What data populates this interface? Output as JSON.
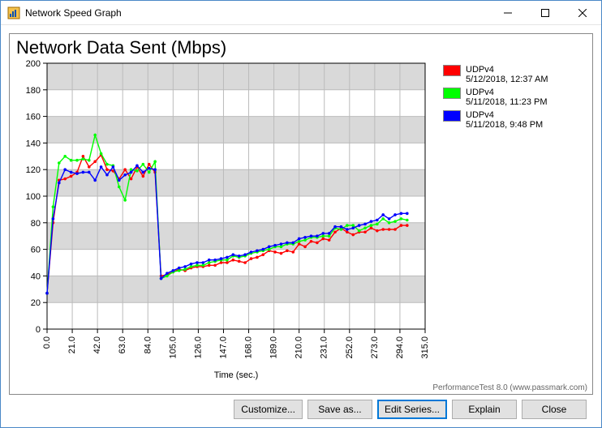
{
  "window": {
    "title": "Network Speed Graph"
  },
  "chart": {
    "title": "Network Data Sent (Mbps)"
  },
  "chart_data": {
    "type": "line",
    "title": "Network Data Sent (Mbps)",
    "xlabel": "Time (sec.)",
    "ylabel": "",
    "ylim": [
      0,
      200
    ],
    "xlim": [
      0,
      315
    ],
    "xticks": [
      0.0,
      21.0,
      42.0,
      63.0,
      84.0,
      105.0,
      126.0,
      147.0,
      168.0,
      189.0,
      210.0,
      231.0,
      252.0,
      273.0,
      294.0,
      315.0
    ],
    "yticks": [
      0,
      20,
      40,
      60,
      80,
      100,
      120,
      140,
      160,
      180,
      200
    ],
    "x": [
      0,
      5,
      10,
      15,
      20,
      25,
      30,
      35,
      40,
      45,
      50,
      55,
      60,
      65,
      70,
      75,
      80,
      85,
      90,
      95,
      100,
      105,
      110,
      115,
      120,
      125,
      130,
      135,
      140,
      145,
      150,
      155,
      160,
      165,
      170,
      175,
      180,
      185,
      190,
      195,
      200,
      205,
      210,
      215,
      220,
      225,
      230,
      235,
      240,
      245,
      250,
      255,
      260,
      265,
      270,
      275,
      280,
      285,
      290,
      295,
      300
    ],
    "series": [
      {
        "name": "UDPv4",
        "subtitle": "5/12/2018, 12:37 AM",
        "color": "#ff0000",
        "values": [
          27,
          80,
          112,
          113,
          115,
          118,
          130,
          122,
          126,
          131,
          120,
          119,
          113,
          120,
          113,
          122,
          115,
          124,
          118,
          40,
          41,
          43,
          45,
          44,
          46,
          47,
          47,
          48,
          48,
          50,
          50,
          52,
          51,
          50,
          53,
          54,
          56,
          59,
          58,
          57,
          59,
          58,
          64,
          62,
          66,
          65,
          68,
          67,
          73,
          76,
          73,
          71,
          73,
          73,
          76,
          74,
          75,
          75,
          75,
          78,
          78
        ]
      },
      {
        "name": "UDPv4",
        "subtitle": "5/11/2018, 11:23 PM",
        "color": "#00ff00",
        "values": [
          27,
          92,
          125,
          130,
          127,
          127,
          128,
          127,
          146,
          132,
          124,
          123,
          107,
          97,
          120,
          119,
          124,
          118,
          126,
          38,
          40,
          43,
          44,
          45,
          47,
          48,
          48,
          50,
          51,
          52,
          52,
          55,
          54,
          55,
          57,
          58,
          59,
          60,
          62,
          62,
          64,
          64,
          66,
          67,
          69,
          69,
          70,
          70,
          76,
          75,
          78,
          78,
          74,
          76,
          78,
          79,
          83,
          80,
          81,
          83,
          82
        ]
      },
      {
        "name": "UDPv4",
        "subtitle": "5/11/2018, 9:48 PM",
        "color": "#0000ff",
        "values": [
          27,
          83,
          110,
          120,
          118,
          117,
          118,
          118,
          112,
          122,
          116,
          122,
          112,
          116,
          118,
          123,
          118,
          121,
          120,
          38,
          42,
          44,
          46,
          47,
          49,
          50,
          50,
          52,
          52,
          53,
          54,
          56,
          55,
          56,
          58,
          59,
          60,
          62,
          63,
          64,
          65,
          65,
          68,
          69,
          70,
          70,
          72,
          72,
          77,
          77,
          75,
          76,
          78,
          79,
          81,
          82,
          86,
          83,
          86,
          87,
          87
        ]
      }
    ]
  },
  "legend": {
    "items": [
      {
        "name": "UDPv4",
        "subtitle": "5/12/2018, 12:37 AM",
        "color": "#ff0000"
      },
      {
        "name": "UDPv4",
        "subtitle": "5/11/2018, 11:23 PM",
        "color": "#00ff00"
      },
      {
        "name": "UDPv4",
        "subtitle": "5/11/2018, 9:48 PM",
        "color": "#0000ff"
      }
    ]
  },
  "attribution": "PerformanceTest 8.0 (www.passmark.com)",
  "buttons": {
    "customize": "Customize...",
    "save_as": "Save as...",
    "edit_series": "Edit Series...",
    "explain": "Explain",
    "close": "Close"
  }
}
